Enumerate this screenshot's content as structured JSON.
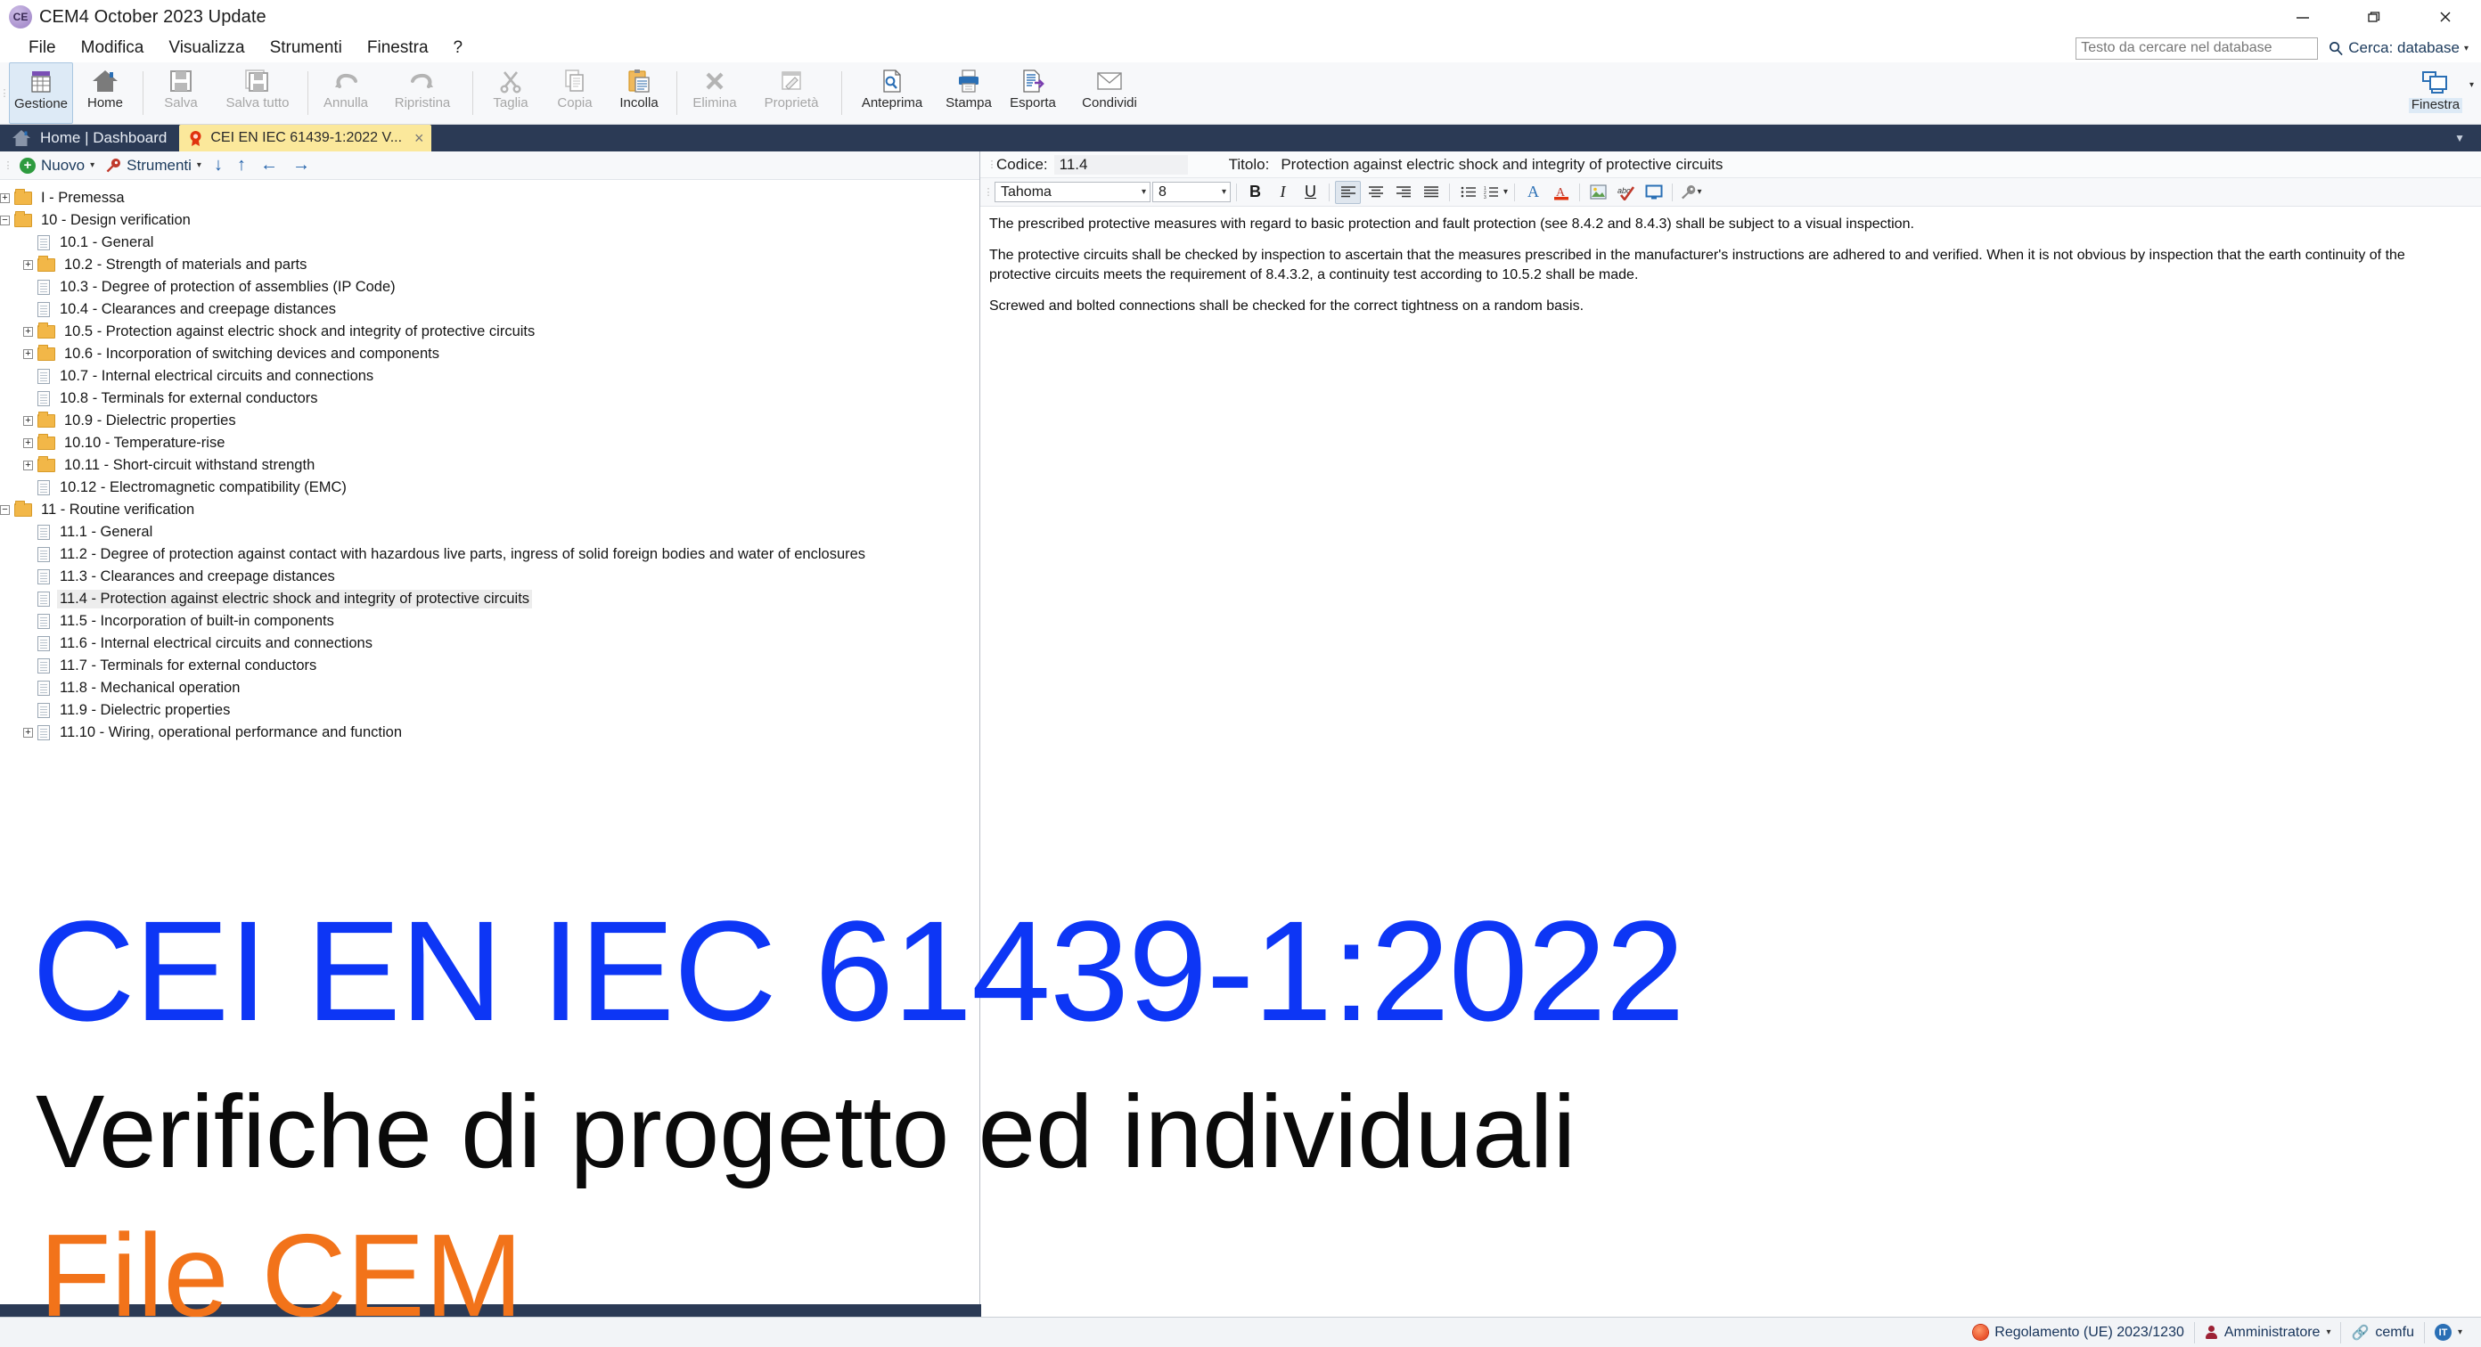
{
  "window": {
    "title": "CEM4 October 2023 Update",
    "app_icon": "ce-mark-icon",
    "minimize": "minimize-icon",
    "maximize": "restore-icon",
    "close": "close-icon"
  },
  "menu": {
    "items": [
      "File",
      "Modifica",
      "Visualizza",
      "Strumenti",
      "Finestra",
      "?"
    ]
  },
  "search": {
    "placeholder": "Testo da cercare nel database",
    "value": "",
    "scope_label": "Cerca: database",
    "icon": "search-icon"
  },
  "ribbon": {
    "buttons": [
      {
        "label": "Gestione",
        "icon": "grid-purple-icon",
        "selected": true,
        "disabled": false
      },
      {
        "label": "Home",
        "icon": "home-icon",
        "selected": false,
        "disabled": false
      },
      {
        "label": "Salva",
        "icon": "save-icon",
        "selected": false,
        "disabled": true
      },
      {
        "label": "Salva tutto",
        "icon": "save-all-icon",
        "selected": false,
        "disabled": true
      },
      {
        "label": "Annulla",
        "icon": "undo-icon",
        "selected": false,
        "disabled": true
      },
      {
        "label": "Ripristina",
        "icon": "redo-icon",
        "selected": false,
        "disabled": true
      },
      {
        "label": "Taglia",
        "icon": "scissors-icon",
        "selected": false,
        "disabled": true
      },
      {
        "label": "Copia",
        "icon": "copy-icon",
        "selected": false,
        "disabled": true
      },
      {
        "label": "Incolla",
        "icon": "paste-icon",
        "selected": false,
        "disabled": false
      },
      {
        "label": "Elimina",
        "icon": "delete-x-icon",
        "selected": false,
        "disabled": true
      },
      {
        "label": "Proprietà",
        "icon": "properties-icon",
        "selected": false,
        "disabled": true
      },
      {
        "label": "Anteprima",
        "icon": "print-preview-icon",
        "selected": false,
        "disabled": false
      },
      {
        "label": "Stampa",
        "icon": "printer-icon",
        "selected": false,
        "disabled": false
      },
      {
        "label": "Esporta",
        "icon": "export-icon",
        "selected": false,
        "disabled": false
      },
      {
        "label": "Condividi",
        "icon": "envelope-icon",
        "selected": false,
        "disabled": false
      }
    ],
    "window_button": {
      "label": "Finestra",
      "icon": "windows-arrange-icon"
    },
    "collapse_icon": "chevron-down-icon"
  },
  "tabs": {
    "home": {
      "label": "Home | Dashboard",
      "icon": "home-icon"
    },
    "document": {
      "label": "CEI EN IEC 61439-1:2022 V...",
      "icon": "rosette-icon",
      "close": "×",
      "active": true
    }
  },
  "tree_toolbar": {
    "new_label": "Nuovo",
    "tools_label": "Strumenti",
    "caret": "▾",
    "nav_icons": [
      "arrow-down-icon",
      "arrow-up-icon",
      "arrow-left-icon",
      "arrow-right-icon"
    ]
  },
  "tree": {
    "nodes": [
      {
        "label": "I - Premessa",
        "level": 0,
        "type": "folder",
        "expander": "+",
        "selected": false
      },
      {
        "label": "10 - Design verification",
        "level": 0,
        "type": "folder",
        "expander": "−",
        "selected": false
      },
      {
        "label": "10.1 - General",
        "level": 1,
        "type": "doc",
        "expander": "",
        "selected": false
      },
      {
        "label": "10.2 - Strength of materials and parts",
        "level": 1,
        "type": "folder",
        "expander": "+",
        "selected": false
      },
      {
        "label": "10.3 - Degree of protection of assemblies (IP Code)",
        "level": 1,
        "type": "doc",
        "expander": "",
        "selected": false
      },
      {
        "label": "10.4 - Clearances and creepage distances",
        "level": 1,
        "type": "doc",
        "expander": "",
        "selected": false
      },
      {
        "label": "10.5 - Protection against electric shock and integrity of protective circuits",
        "level": 1,
        "type": "folder",
        "expander": "+",
        "selected": false
      },
      {
        "label": "10.6 - Incorporation of switching devices and components",
        "level": 1,
        "type": "folder",
        "expander": "+",
        "selected": false
      },
      {
        "label": "10.7 - Internal electrical circuits and connections",
        "level": 1,
        "type": "doc",
        "expander": "",
        "selected": false
      },
      {
        "label": "10.8 - Terminals for external conductors",
        "level": 1,
        "type": "doc",
        "expander": "",
        "selected": false
      },
      {
        "label": "10.9 - Dielectric properties",
        "level": 1,
        "type": "folder",
        "expander": "+",
        "selected": false
      },
      {
        "label": "10.10 - Temperature-rise",
        "level": 1,
        "type": "folder",
        "expander": "+",
        "selected": false
      },
      {
        "label": "10.11 - Short-circuit withstand strength",
        "level": 1,
        "type": "folder",
        "expander": "+",
        "selected": false
      },
      {
        "label": "10.12 - Electromagnetic compatibility (EMC)",
        "level": 1,
        "type": "doc",
        "expander": "",
        "selected": false
      },
      {
        "label": "11 - Routine verification",
        "level": 0,
        "type": "folder",
        "expander": "−",
        "selected": false
      },
      {
        "label": "11.1 - General",
        "level": 1,
        "type": "doc",
        "expander": "",
        "selected": false
      },
      {
        "label": "11.2 - Degree of protection against contact with hazardous live parts, ingress of solid foreign bodies and water of enclosures",
        "level": 1,
        "type": "doc",
        "expander": "",
        "selected": false
      },
      {
        "label": "11.3 - Clearances and creepage distances",
        "level": 1,
        "type": "doc",
        "expander": "",
        "selected": false
      },
      {
        "label": "11.4 - Protection against electric shock and integrity of protective circuits",
        "level": 1,
        "type": "doc",
        "expander": "",
        "selected": true
      },
      {
        "label": "11.5 - Incorporation of built-in components",
        "level": 1,
        "type": "doc",
        "expander": "",
        "selected": false
      },
      {
        "label": "11.6 - Internal electrical circuits and connections",
        "level": 1,
        "type": "doc",
        "expander": "",
        "selected": false
      },
      {
        "label": "11.7 - Terminals for external conductors",
        "level": 1,
        "type": "doc",
        "expander": "",
        "selected": false
      },
      {
        "label": "11.8 - Mechanical operation",
        "level": 1,
        "type": "doc",
        "expander": "",
        "selected": false
      },
      {
        "label": "11.9 - Dielectric properties",
        "level": 1,
        "type": "doc",
        "expander": "",
        "selected": false
      },
      {
        "label": "11.10 - Wiring, operational performance and function",
        "level": 1,
        "type": "doc",
        "expander": "+",
        "selected": false
      }
    ]
  },
  "detail": {
    "codice_label": "Codice:",
    "codice_value": "11.4",
    "titolo_label": "Titolo:",
    "titolo_value": "Protection against electric shock and integrity of protective circuits",
    "format_toolbar": {
      "font_name": "Tahoma",
      "font_size": "8",
      "bold": "B",
      "italic": "I",
      "underline": "U",
      "align_left": "align-left-icon",
      "align_center": "align-center-icon",
      "align_right": "align-right-icon",
      "align_justify": "align-justify-icon",
      "bullet_list": "bullet-list-icon",
      "numbered_list": "numbered-list-icon",
      "font_color": "font-color-icon",
      "highlight": "text-highlight-icon",
      "insert_image": "insert-image-icon",
      "spellcheck": "spellcheck-icon",
      "screen": "monitor-icon",
      "tools": "wrench-icon"
    },
    "paragraphs": [
      "The prescribed protective measures with regard to basic protection and fault protection (see 8.4.2 and 8.4.3) shall be subject to a visual inspection.",
      "The protective circuits shall be checked by inspection to ascertain that the measures prescribed in the manufacturer's instructions are adhered to and verified. When it is not obvious by inspection that the earth continuity of the protective circuits meets the requirement of 8.4.3.2, a continuity test according to 10.5.2 shall be made.",
      "Screwed and bolted connections shall be checked for the correct tightness on a random basis."
    ]
  },
  "overlay": {
    "line1": "CEI EN IEC 61439-1:2022",
    "line2": "Verifiche di progetto ed individuali",
    "line3": "File CEM",
    "color1": "#0d36f5",
    "color2": "#0a0a0a",
    "color3": "#f2731a"
  },
  "statusbar": {
    "regulation": "Regolamento (UE) 2023/1230",
    "user": "Amministratore",
    "connection": "cemfu",
    "language": "IT",
    "caret": "▾"
  }
}
